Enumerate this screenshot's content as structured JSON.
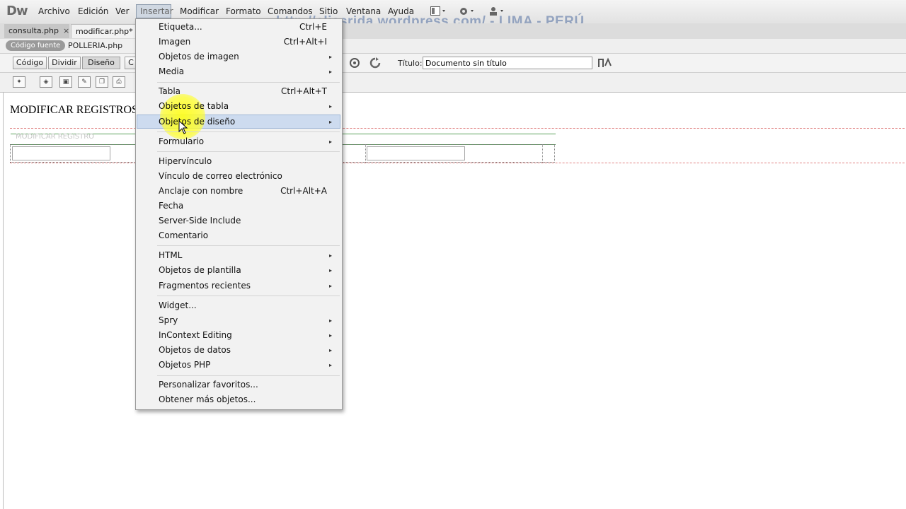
{
  "app": {
    "logo": "Dw"
  },
  "menubar": {
    "items": [
      "Archivo",
      "Edición",
      "Ver",
      "Insertar",
      "Modificar",
      "Formato",
      "Comandos",
      "Sitio",
      "Ventana",
      "Ayuda"
    ]
  },
  "watermark": "http://eliasrida.wordpress.com/ - LIMA - PERÚ",
  "tabs": [
    {
      "label": "consulta.php",
      "close": "×"
    },
    {
      "label": "modificar.php*",
      "close": "×"
    }
  ],
  "related": {
    "source_label": "Código fuente",
    "file": "POLLERIA.php"
  },
  "doc_toolbar": {
    "codigo": "Código",
    "dividir": "Dividir",
    "diseno": "Diseño",
    "c_partial": "C",
    "title_label": "Título:",
    "title_value": "Documento sin título"
  },
  "design": {
    "heading": "MODIFICAR REGISTROS",
    "caption": "MODIFICAR REGISTRO"
  },
  "insert_menu": {
    "items": [
      {
        "label": "Etiqueta...",
        "shortcut": "Ctrl+E"
      },
      {
        "label": "Imagen",
        "shortcut": "Ctrl+Alt+I"
      },
      {
        "label": "Objetos de imagen",
        "submenu": true
      },
      {
        "label": "Media",
        "submenu": true
      },
      {
        "label": "Tabla",
        "shortcut": "Ctrl+Alt+T"
      },
      {
        "label": "Objetos de tabla",
        "submenu": true
      },
      {
        "label": "Objetos de diseño",
        "submenu": true,
        "highlighted": true
      },
      {
        "label": "Formulario",
        "submenu": true
      },
      {
        "label": "Hipervínculo"
      },
      {
        "label": "Vínculo de correo electrónico"
      },
      {
        "label": "Anclaje con nombre",
        "shortcut": "Ctrl+Alt+A"
      },
      {
        "label": "Fecha"
      },
      {
        "label": "Server-Side Include"
      },
      {
        "label": "Comentario"
      },
      {
        "label": "HTML",
        "submenu": true
      },
      {
        "label": "Objetos de plantilla",
        "submenu": true
      },
      {
        "label": "Fragmentos recientes",
        "submenu": true
      },
      {
        "label": "Widget..."
      },
      {
        "label": "Spry",
        "submenu": true
      },
      {
        "label": "InContext Editing",
        "submenu": true
      },
      {
        "label": "Objetos de datos",
        "submenu": true
      },
      {
        "label": "Objetos PHP",
        "submenu": true
      },
      {
        "label": "Personalizar favoritos..."
      },
      {
        "label": "Obtener más objetos..."
      }
    ]
  },
  "icons": {
    "arrow": "▸",
    "layout": "layout-icon",
    "gear": "gear-icon",
    "user": "user-icon"
  },
  "colors": {
    "highlight": "#cddbef",
    "spotlight": "#ffff14"
  }
}
